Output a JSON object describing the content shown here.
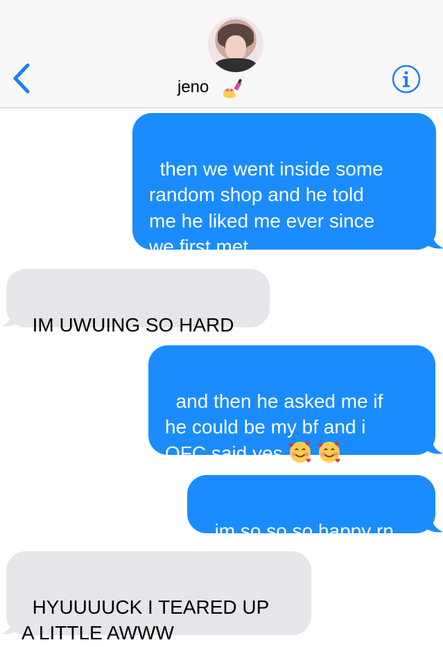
{
  "header": {
    "contact_name": "jeno",
    "contact_emoji": "nail-polish-emoji",
    "back_icon": "chevron-left-icon",
    "info_icon": "info-icon",
    "accent_color": "#1a7efb"
  },
  "messages": [
    {
      "direction": "sent",
      "text": "then we went inside some\nrandom shop and he told\nme he liked me ever since\nwe first met"
    },
    {
      "direction": "received",
      "text": "IM UWUING SO HARD"
    },
    {
      "direction": "sent",
      "text": "and then he asked me if\nhe could be my bf and i\nOFC said yes",
      "emojis": [
        "smiling-face-with-hearts-emoji",
        "smiling-face-with-hearts-emoji"
      ]
    },
    {
      "direction": "sent",
      "text": "im so so so happy rn"
    },
    {
      "direction": "received",
      "text": "HYUUUUCK I TEARED UP\nA LITTLE AWWW"
    }
  ],
  "colors": {
    "sent_bubble": "#1a8cff",
    "received_bubble": "#e5e5ea",
    "header_bg": "#f7f7f7"
  }
}
